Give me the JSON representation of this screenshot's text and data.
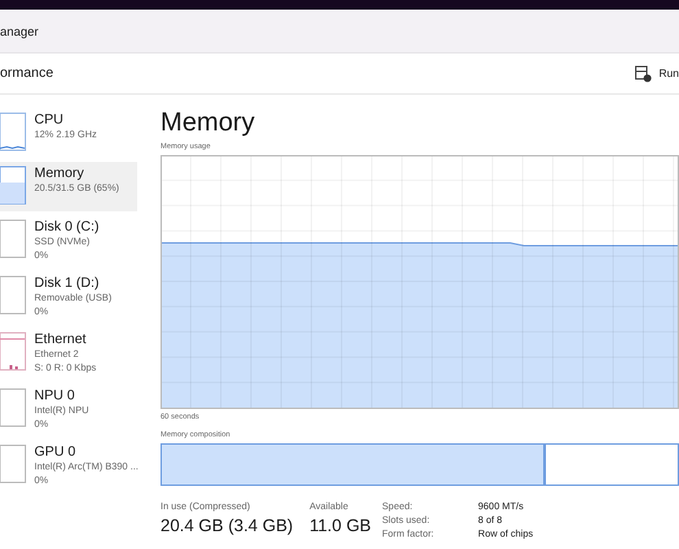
{
  "window": {
    "title": "anager"
  },
  "header": {
    "title": "ormance",
    "run_button": "Run"
  },
  "sidebar": {
    "items": [
      {
        "kind": "cpu",
        "name": "CPU",
        "lines": [
          "12%  2.19 GHz"
        ],
        "selected": false
      },
      {
        "kind": "memory",
        "name": "Memory",
        "lines": [
          "20.5/31.5 GB (65%)"
        ],
        "selected": true
      },
      {
        "kind": "blank",
        "name": "Disk 0 (C:)",
        "lines": [
          "SSD (NVMe)",
          "0%"
        ],
        "selected": false
      },
      {
        "kind": "blank",
        "name": "Disk 1 (D:)",
        "lines": [
          "Removable (USB)",
          "0%"
        ],
        "selected": false
      },
      {
        "kind": "network",
        "name": "Ethernet",
        "lines": [
          "Ethernet 2",
          "S: 0  R: 0 Kbps"
        ],
        "selected": false
      },
      {
        "kind": "blank",
        "name": "NPU 0",
        "lines": [
          "Intel(R) NPU",
          "0%"
        ],
        "selected": false
      },
      {
        "kind": "blank",
        "name": "GPU 0",
        "lines": [
          "Intel(R) Arc(TM) B390 ...",
          "0%"
        ],
        "selected": false
      }
    ]
  },
  "main": {
    "title": "Memory",
    "usage_label": "Memory usage",
    "time_label": "60 seconds",
    "composition_label": "Memory composition",
    "composition": {
      "level": 0.745
    },
    "stats": [
      {
        "label": "In use (Compressed)",
        "value": "20.4 GB (3.4 GB)"
      },
      {
        "label": "Available",
        "value": "11.0 GB"
      }
    ],
    "details": [
      {
        "label": "Speed:",
        "value": "9600 MT/s"
      },
      {
        "label": "Slots used:",
        "value": "8 of 8"
      },
      {
        "label": "Form factor:",
        "value": "Row of chips"
      }
    ]
  }
}
